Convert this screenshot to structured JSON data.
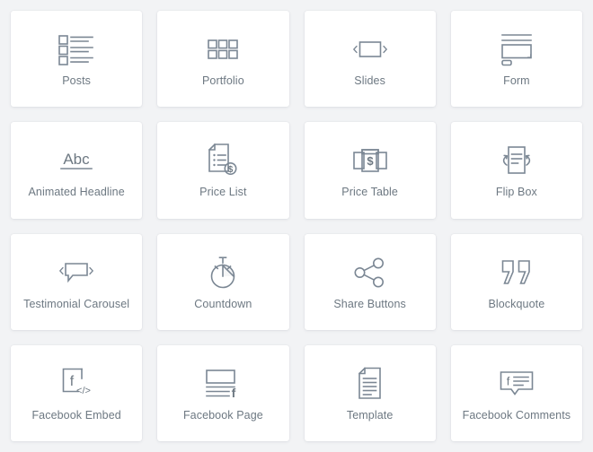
{
  "panel": {
    "title": "Widgets Panel",
    "background_color": "#f2f3f5",
    "card_color": "#ffffff",
    "icon_color": "#7b8794",
    "label_color": "#6d7882",
    "columns": 4,
    "rows": 4
  },
  "widgets": [
    {
      "label": "Posts",
      "icon": "posts-list-icon"
    },
    {
      "label": "Portfolio",
      "icon": "grid-squares-icon"
    },
    {
      "label": "Slides",
      "icon": "slides-carousel-icon"
    },
    {
      "label": "Form",
      "icon": "form-fields-icon"
    },
    {
      "label": "Animated Headline",
      "icon": "abc-underline-icon"
    },
    {
      "label": "Price List",
      "icon": "price-list-document-icon"
    },
    {
      "label": "Price Table",
      "icon": "price-table-panels-icon"
    },
    {
      "label": "Flip Box",
      "icon": "flip-box-rotate-icon"
    },
    {
      "label": "Testimonial Carousel",
      "icon": "speech-bubble-carousel-icon"
    },
    {
      "label": "Countdown",
      "icon": "stopwatch-icon"
    },
    {
      "label": "Share Buttons",
      "icon": "share-nodes-icon"
    },
    {
      "label": "Blockquote",
      "icon": "quotation-marks-icon"
    },
    {
      "label": "Facebook Embed",
      "icon": "facebook-code-icon"
    },
    {
      "label": "Facebook Page",
      "icon": "facebook-page-icon"
    },
    {
      "label": "Template",
      "icon": "document-page-icon"
    },
    {
      "label": "Facebook Comments",
      "icon": "facebook-comment-bubble-icon"
    }
  ]
}
